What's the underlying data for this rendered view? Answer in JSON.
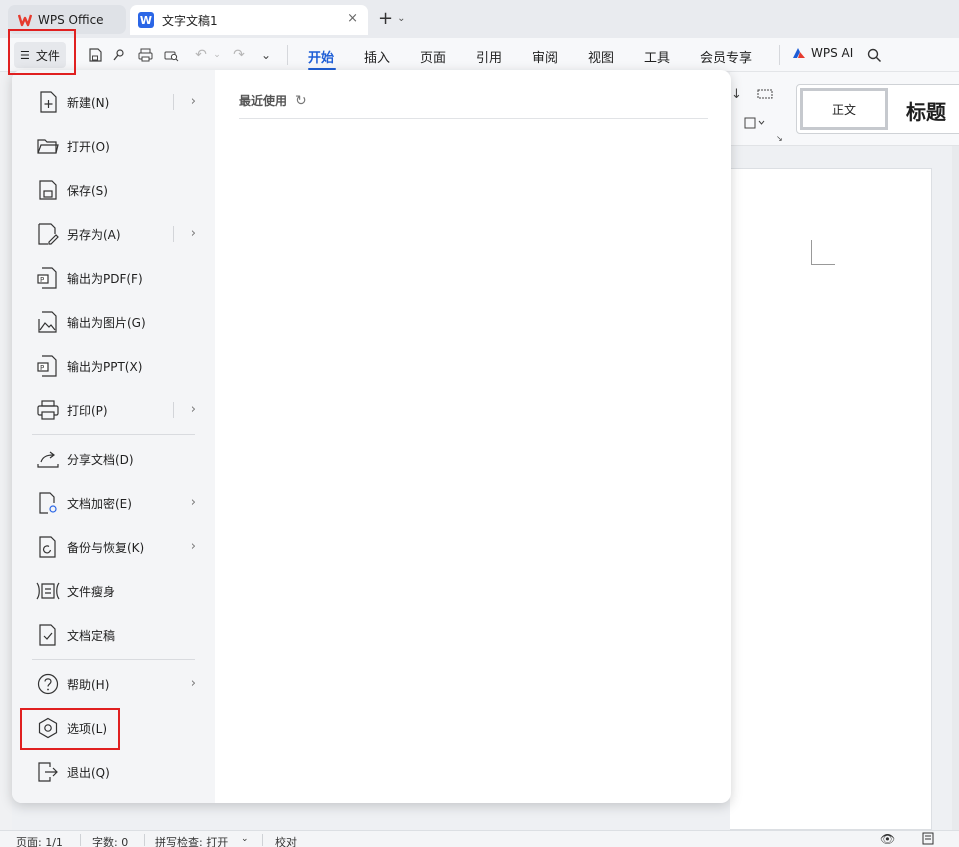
{
  "tabs": {
    "home_tab_label": "WPS Office",
    "doc_tab_label": "文字文稿1",
    "doc_icon_letter": "W",
    "close_glyph": "×",
    "new_tab_glyph": "+"
  },
  "ribbon": {
    "file_button_label": "文件",
    "tabs": [
      "开始",
      "插入",
      "页面",
      "引用",
      "审阅",
      "视图",
      "工具",
      "会员专享"
    ],
    "active_tab": "开始",
    "ai_label": "WPS AI"
  },
  "styles": {
    "normal": "正文",
    "heading": "标题"
  },
  "file_menu": {
    "items": [
      {
        "label": "新建(N)",
        "icon": "new-doc-icon",
        "submenu": true
      },
      {
        "label": "打开(O)",
        "icon": "folder-open-icon",
        "submenu": false
      },
      {
        "label": "保存(S)",
        "icon": "save-icon",
        "submenu": false
      },
      {
        "label": "另存为(A)",
        "icon": "save-as-icon",
        "submenu": true
      },
      {
        "label": "输出为PDF(F)",
        "icon": "export-pdf-icon",
        "submenu": false
      },
      {
        "label": "输出为图片(G)",
        "icon": "export-image-icon",
        "submenu": false
      },
      {
        "label": "输出为PPT(X)",
        "icon": "export-ppt-icon",
        "submenu": false
      },
      {
        "label": "打印(P)",
        "icon": "print-icon",
        "submenu": true
      },
      {
        "label": "分享文档(D)",
        "icon": "share-icon",
        "submenu": false
      },
      {
        "label": "文档加密(E)",
        "icon": "encrypt-icon",
        "submenu": true
      },
      {
        "label": "备份与恢复(K)",
        "icon": "backup-icon",
        "submenu": true
      },
      {
        "label": "文件瘦身",
        "icon": "slim-file-icon",
        "submenu": false
      },
      {
        "label": "文档定稿",
        "icon": "finalize-icon",
        "submenu": false
      },
      {
        "label": "帮助(H)",
        "icon": "help-icon",
        "submenu": true
      },
      {
        "label": "选项(L)",
        "icon": "options-icon",
        "submenu": false
      },
      {
        "label": "退出(Q)",
        "icon": "exit-icon",
        "submenu": false
      }
    ],
    "recent_title": "最近使用"
  },
  "status": {
    "page": "页面: 1/1",
    "words": "字数: 0",
    "spell": "拼写检查: 打开",
    "proof": "校对"
  },
  "colors": {
    "accent": "#1e5ed6",
    "highlight_box": "#e02020",
    "wps_logo": "#e63b2e",
    "doc_icon": "#2b66e6"
  }
}
